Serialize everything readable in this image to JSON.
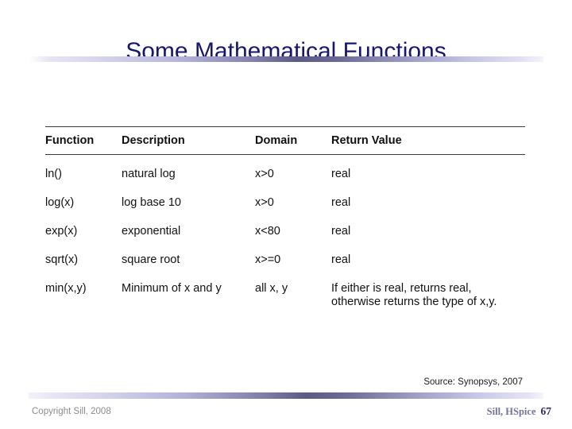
{
  "slide": {
    "title": "Some Mathematical Functions"
  },
  "table": {
    "headers": [
      "Function",
      "Description",
      "Domain",
      "Return Value"
    ],
    "rows": [
      {
        "function": "ln()",
        "description": "natural log",
        "domain": "x>0",
        "return_value": "real",
        "return_value_line2": ""
      },
      {
        "function": "log(x)",
        "description": "log base 10",
        "domain": "x>0",
        "return_value": "real",
        "return_value_line2": ""
      },
      {
        "function": "exp(x)",
        "description": "exponential",
        "domain": "x<80",
        "return_value": "real",
        "return_value_line2": ""
      },
      {
        "function": "sqrt(x)",
        "description": "square root",
        "domain": "x>=0",
        "return_value": "real",
        "return_value_line2": ""
      },
      {
        "function": "min(x,y)",
        "description": "Minimum of x and y",
        "domain": "all x, y",
        "return_value": "If either is real, returns real,",
        "return_value_line2": "otherwise returns the type of x,y."
      }
    ]
  },
  "source_note": "Source: Synopsys, 2007",
  "footer": {
    "copyright": "Copyright Sill, 2008",
    "course": "Sill, HSpice",
    "page_number": "67"
  },
  "colors": {
    "title": "#16166e",
    "rule_center": "#5b5a85",
    "rule_edge": "#e6e5f4",
    "body_text": "#111111",
    "copyright_text": "#8a8a8a",
    "course_text": "#73739a",
    "page_number_text": "#2b2b5e"
  }
}
